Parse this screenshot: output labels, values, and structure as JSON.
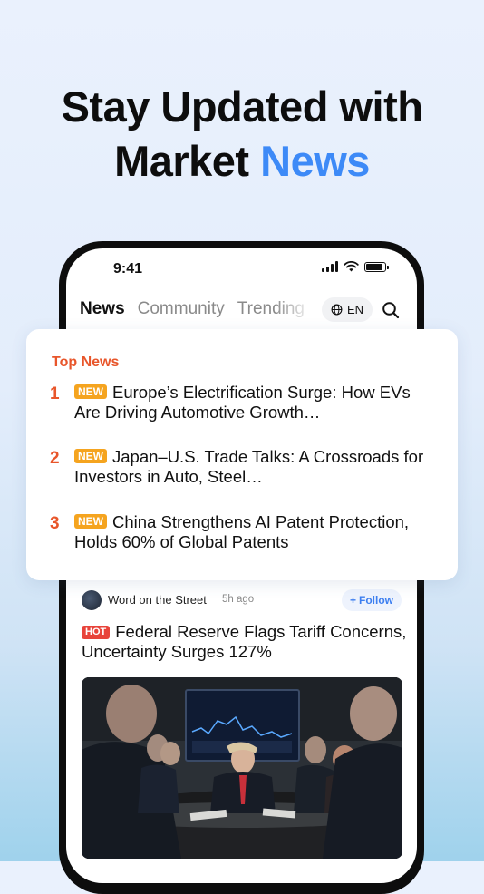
{
  "headline": {
    "line1": "Stay Updated with",
    "line2_prefix": "Market ",
    "line2_accent": "News",
    "accent_color": "#3d8af7"
  },
  "status_bar": {
    "time": "9:41",
    "icons": [
      "cellular-signal-icon",
      "wifi-icon",
      "battery-icon"
    ]
  },
  "nav": {
    "tabs": [
      {
        "label": "News",
        "active": true
      },
      {
        "label": "Community",
        "active": false
      },
      {
        "label": "Trending",
        "active": false
      }
    ],
    "language": {
      "label": "EN",
      "icon": "globe-icon"
    },
    "search_icon": "search-icon"
  },
  "top_news": {
    "title": "Top News",
    "accent_color": "#e8562b",
    "badge_color": "#f5a41f",
    "items": [
      {
        "rank": "1",
        "badge": "NEW",
        "text": "Europe’s Electrification Surge: How EVs Are Driving Automotive Growth…"
      },
      {
        "rank": "2",
        "badge": "NEW",
        "text": "Japan–U.S. Trade Talks: A Crossroads for Investors in Auto, Steel…"
      },
      {
        "rank": "3",
        "badge": "NEW",
        "text": "China Strengthens AI Patent Protection, Holds 60% of Global Patents"
      }
    ]
  },
  "post": {
    "author": "Word on the Street",
    "time": "5h ago",
    "follow_label": "Follow",
    "badge": "HOT",
    "badge_color": "#e8433a",
    "title": "Federal Reserve Flags Tariff Concerns, Uncertainty Surges 127%",
    "image_alt": "meeting-room-photo"
  }
}
